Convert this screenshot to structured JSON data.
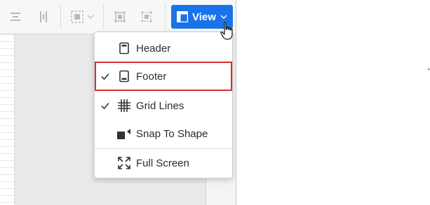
{
  "toolbar": {
    "view_label": "View",
    "icons": [
      "distribute-horizontal-icon",
      "distribute-vertical-icon",
      "selection-icon",
      "group-icon",
      "ungroup-icon",
      "view-layout-icon",
      "chevron-down-icon"
    ]
  },
  "view_menu": {
    "items": [
      {
        "label": "Header",
        "checked": false,
        "icon": "header-icon"
      },
      {
        "label": "Footer",
        "checked": true,
        "icon": "footer-icon",
        "highlighted": true
      },
      {
        "label": "Grid Lines",
        "checked": true,
        "icon": "grid-lines-icon"
      },
      {
        "label": "Snap To Shape",
        "checked": false,
        "icon": "snap-to-shape-icon"
      },
      {
        "label": "Full Screen",
        "checked": false,
        "icon": "full-screen-icon"
      }
    ]
  },
  "colors": {
    "accent": "#1a73e8",
    "highlight_border": "#d32f2f",
    "marker": "#e53935"
  }
}
